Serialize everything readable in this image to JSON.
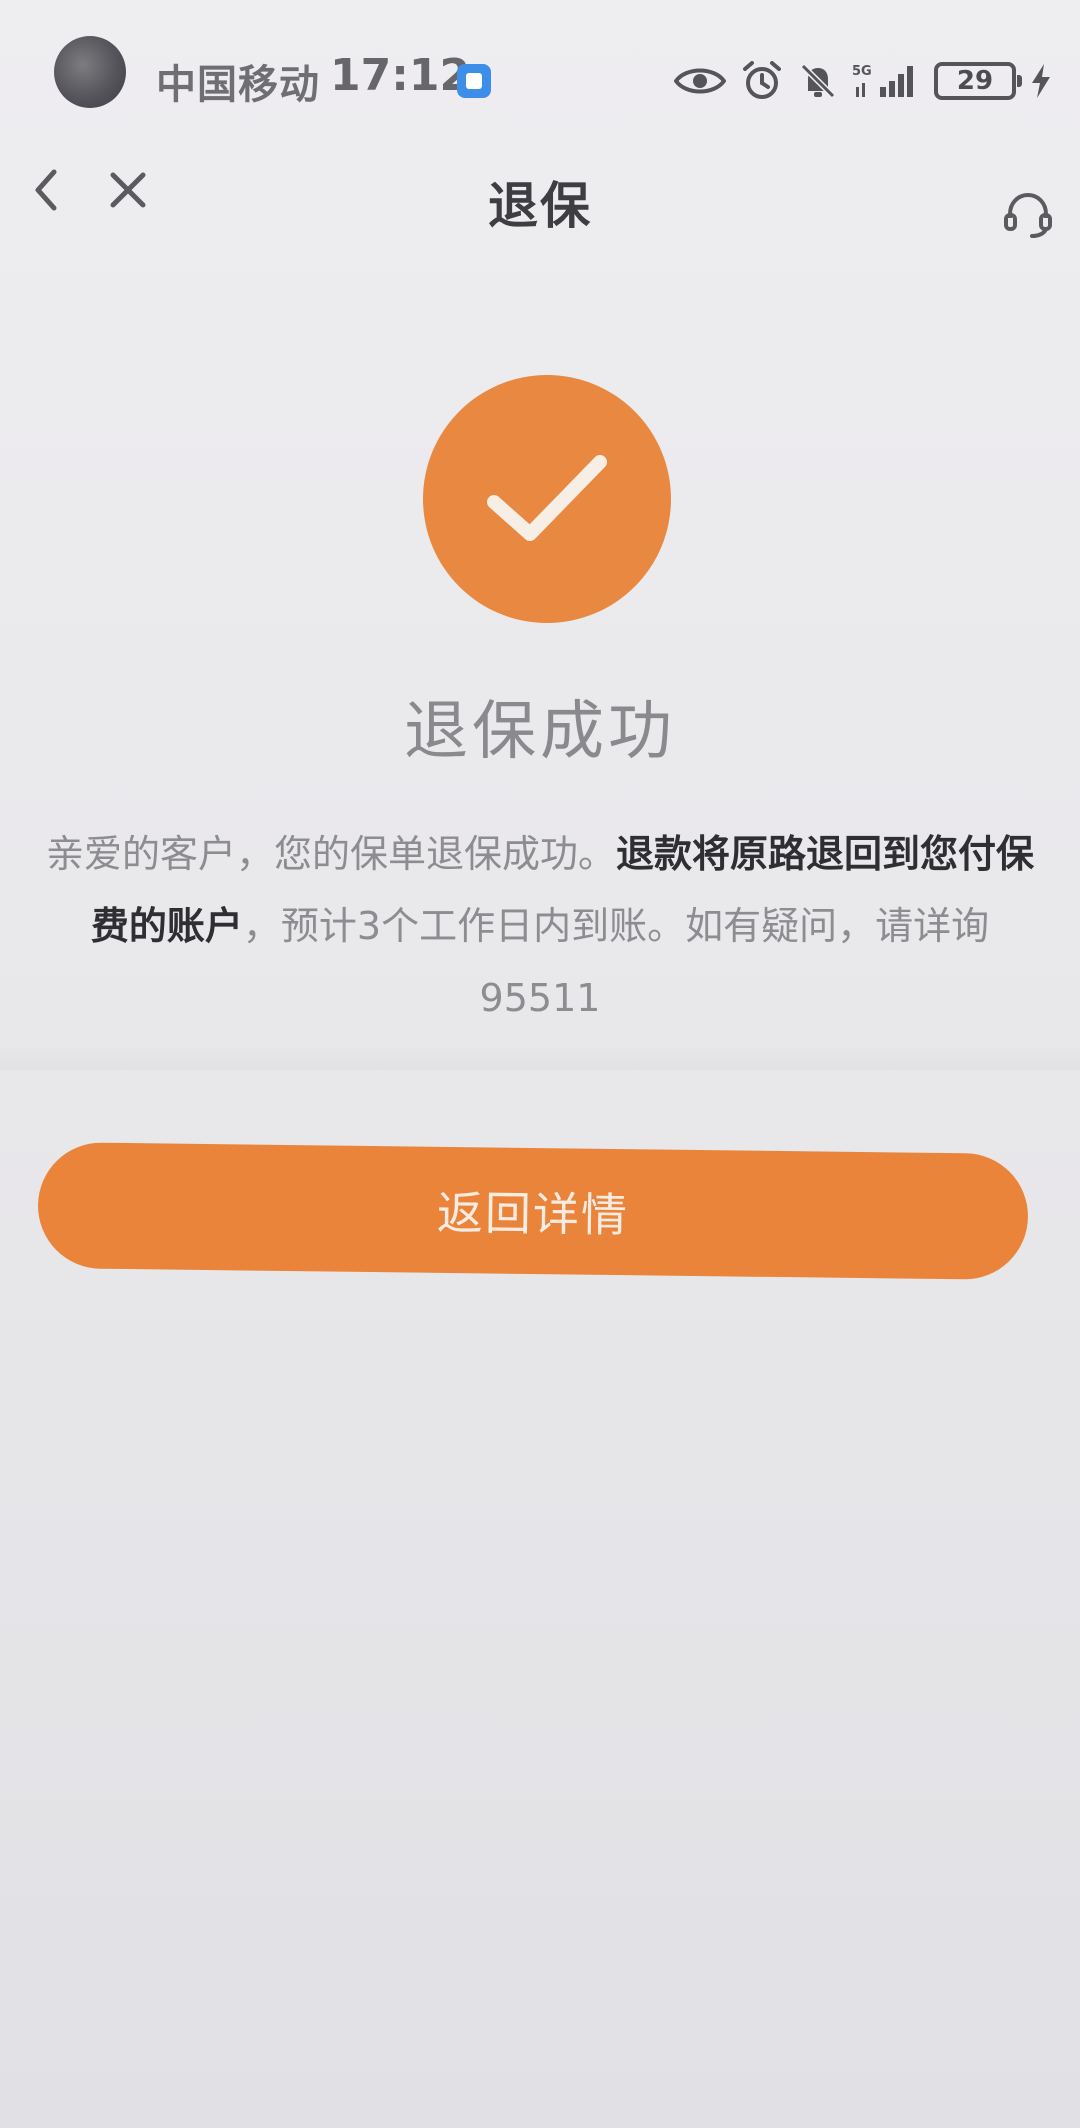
{
  "status_bar": {
    "carrier": "中国移动",
    "time": "17:12",
    "network": "5G",
    "battery": "29"
  },
  "nav": {
    "title": "退保"
  },
  "result": {
    "title": "退保成功",
    "desc_part1": "亲爱的客户，您的保单退保成功。",
    "desc_bold": "退款将原路退回到您付保费的账户",
    "desc_part2": "，预计3个工作日内到账。如有疑问，请详询95511"
  },
  "actions": {
    "return_label": "返回详情"
  },
  "colors": {
    "accent": "#e98840",
    "text_dark": "#2f2e33",
    "text_muted": "#8d8c90"
  },
  "icons": {
    "back": "chevron-left-icon",
    "close": "close-icon",
    "service": "headset-icon",
    "success": "checkmark-icon"
  }
}
